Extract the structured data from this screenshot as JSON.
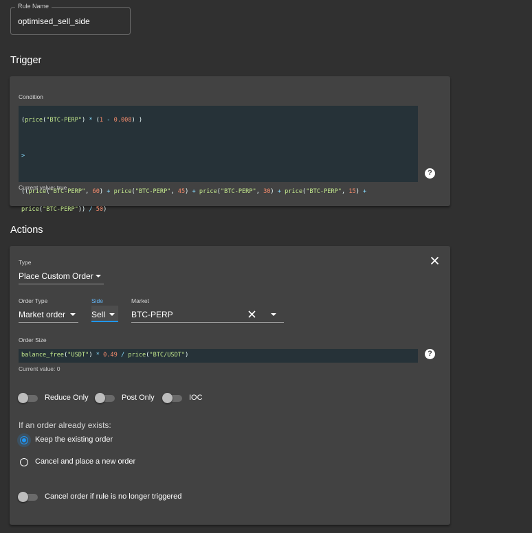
{
  "rule_name": {
    "label": "Rule Name",
    "value": "optimised_sell_side"
  },
  "trigger": {
    "title": "Trigger",
    "condition_label": "Condition",
    "condition_lines": [
      "(price(\"BTC-PERP\") * (1 - 0.008) )",
      "",
      ">",
      "",
      "((price(\"BTC-PERP\", 60) + price(\"BTC-PERP\", 45) + price(\"BTC-PERP\", 30) + price(\"BTC-PERP\", 15) +",
      "price(\"BTC-PERP\")) / 50)"
    ],
    "current_value": "Current value: true",
    "help_icon": "help-circle-icon"
  },
  "actions": {
    "title": "Actions",
    "close_icon": "close-icon",
    "type_label": "Type",
    "type_value": "Place Custom Order",
    "order_type_label": "Order Type",
    "order_type_value": "Market order",
    "side_label": "Side",
    "side_value": "Sell",
    "market_label": "Market",
    "market_value": "BTC-PERP",
    "order_size_label": "Order Size",
    "order_size_expr": "balance_free(\"USDT\") * 0.49 / price(\"BTC/USDT\")",
    "order_size_current": "Current value: 0",
    "toggles": [
      {
        "label": "Reduce Only",
        "on": false
      },
      {
        "label": "Post Only",
        "on": false
      },
      {
        "label": "IOC",
        "on": false
      }
    ],
    "existing_order_label": "If an order already exists:",
    "radio_options": [
      {
        "label": "Keep the existing order",
        "checked": true
      },
      {
        "label": "Cancel and place a new order",
        "checked": false
      }
    ],
    "cancel_toggle": {
      "label": "Cancel order if rule is no longer triggered",
      "on": false
    }
  },
  "colors": {
    "background": "#303030",
    "card": "#424242",
    "code_bg": "#263238",
    "accent": "#2196f3"
  }
}
